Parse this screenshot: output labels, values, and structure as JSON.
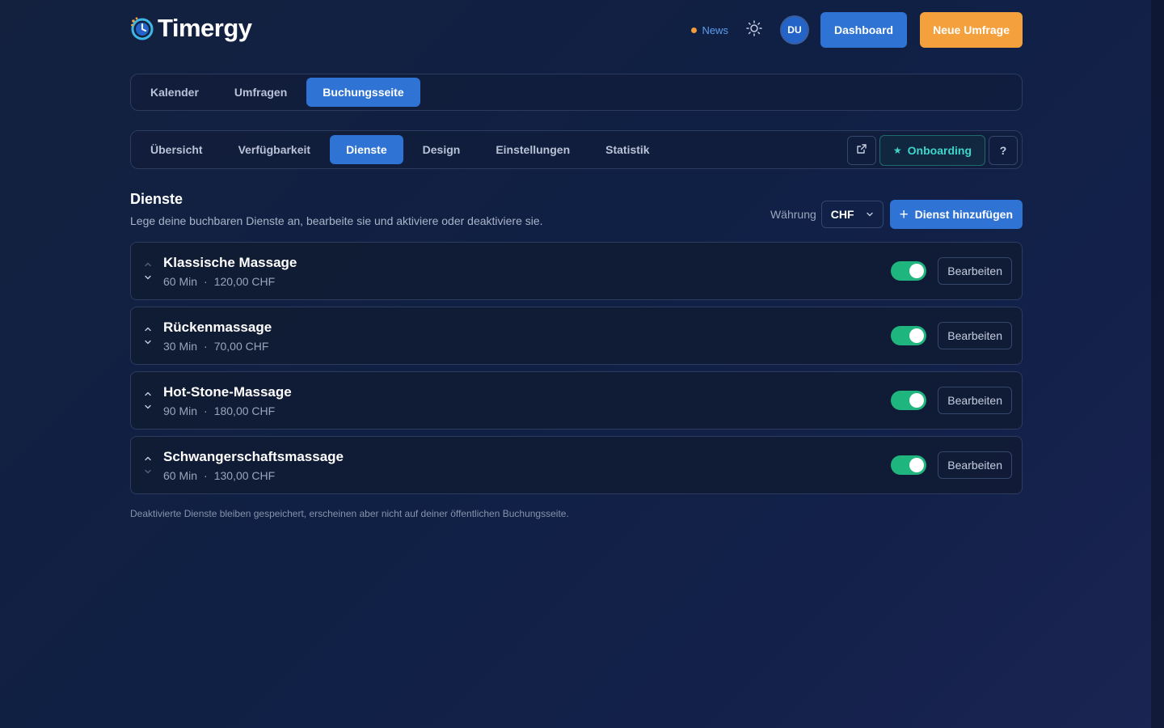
{
  "app": {
    "name": "Timergy"
  },
  "header": {
    "news_label": "News",
    "avatar_initials": "DU",
    "dashboard_label": "Dashboard",
    "new_survey_label": "Neue Umfrage"
  },
  "main_tabs": [
    {
      "label": "Kalender",
      "active": false
    },
    {
      "label": "Umfragen",
      "active": false
    },
    {
      "label": "Buchungsseite",
      "active": true
    }
  ],
  "sub_tabs": [
    {
      "label": "Übersicht",
      "active": false
    },
    {
      "label": "Verfügbarkeit",
      "active": false
    },
    {
      "label": "Dienste",
      "active": true
    },
    {
      "label": "Design",
      "active": false
    },
    {
      "label": "Einstellungen",
      "active": false
    },
    {
      "label": "Statistik",
      "active": false
    }
  ],
  "sub_actions": {
    "onboarding_label": "Onboarding",
    "help_label": "?"
  },
  "section": {
    "title": "Dienste",
    "subtitle": "Lege deine buchbaren Dienste an, bearbeite sie und aktiviere oder deaktiviere sie.",
    "currency_label": "Währung",
    "currency_value": "CHF",
    "add_label": "Dienst hinzufügen"
  },
  "services": [
    {
      "name": "Klassische Massage",
      "duration": "60 Min",
      "price": "120,00 CHF",
      "enabled": true,
      "edit_label": "Bearbeiten"
    },
    {
      "name": "Rückenmassage",
      "duration": "30 Min",
      "price": "70,00 CHF",
      "enabled": true,
      "edit_label": "Bearbeiten"
    },
    {
      "name": "Hot-Stone-Massage",
      "duration": "90 Min",
      "price": "180,00 CHF",
      "enabled": true,
      "edit_label": "Bearbeiten"
    },
    {
      "name": "Schwangerschaftsmassage",
      "duration": "60 Min",
      "price": "130,00 CHF",
      "enabled": true,
      "edit_label": "Bearbeiten"
    }
  ],
  "footnote": "Deaktivierte Dienste bleiben gespeichert, erscheinen aber nicht auf deiner öffentlichen Buchungsseite.",
  "colors": {
    "primary": "#2f74d4",
    "accent": "#f4a13d",
    "toggle_on": "#1fb57f",
    "onboarding": "#3ed6c9"
  }
}
